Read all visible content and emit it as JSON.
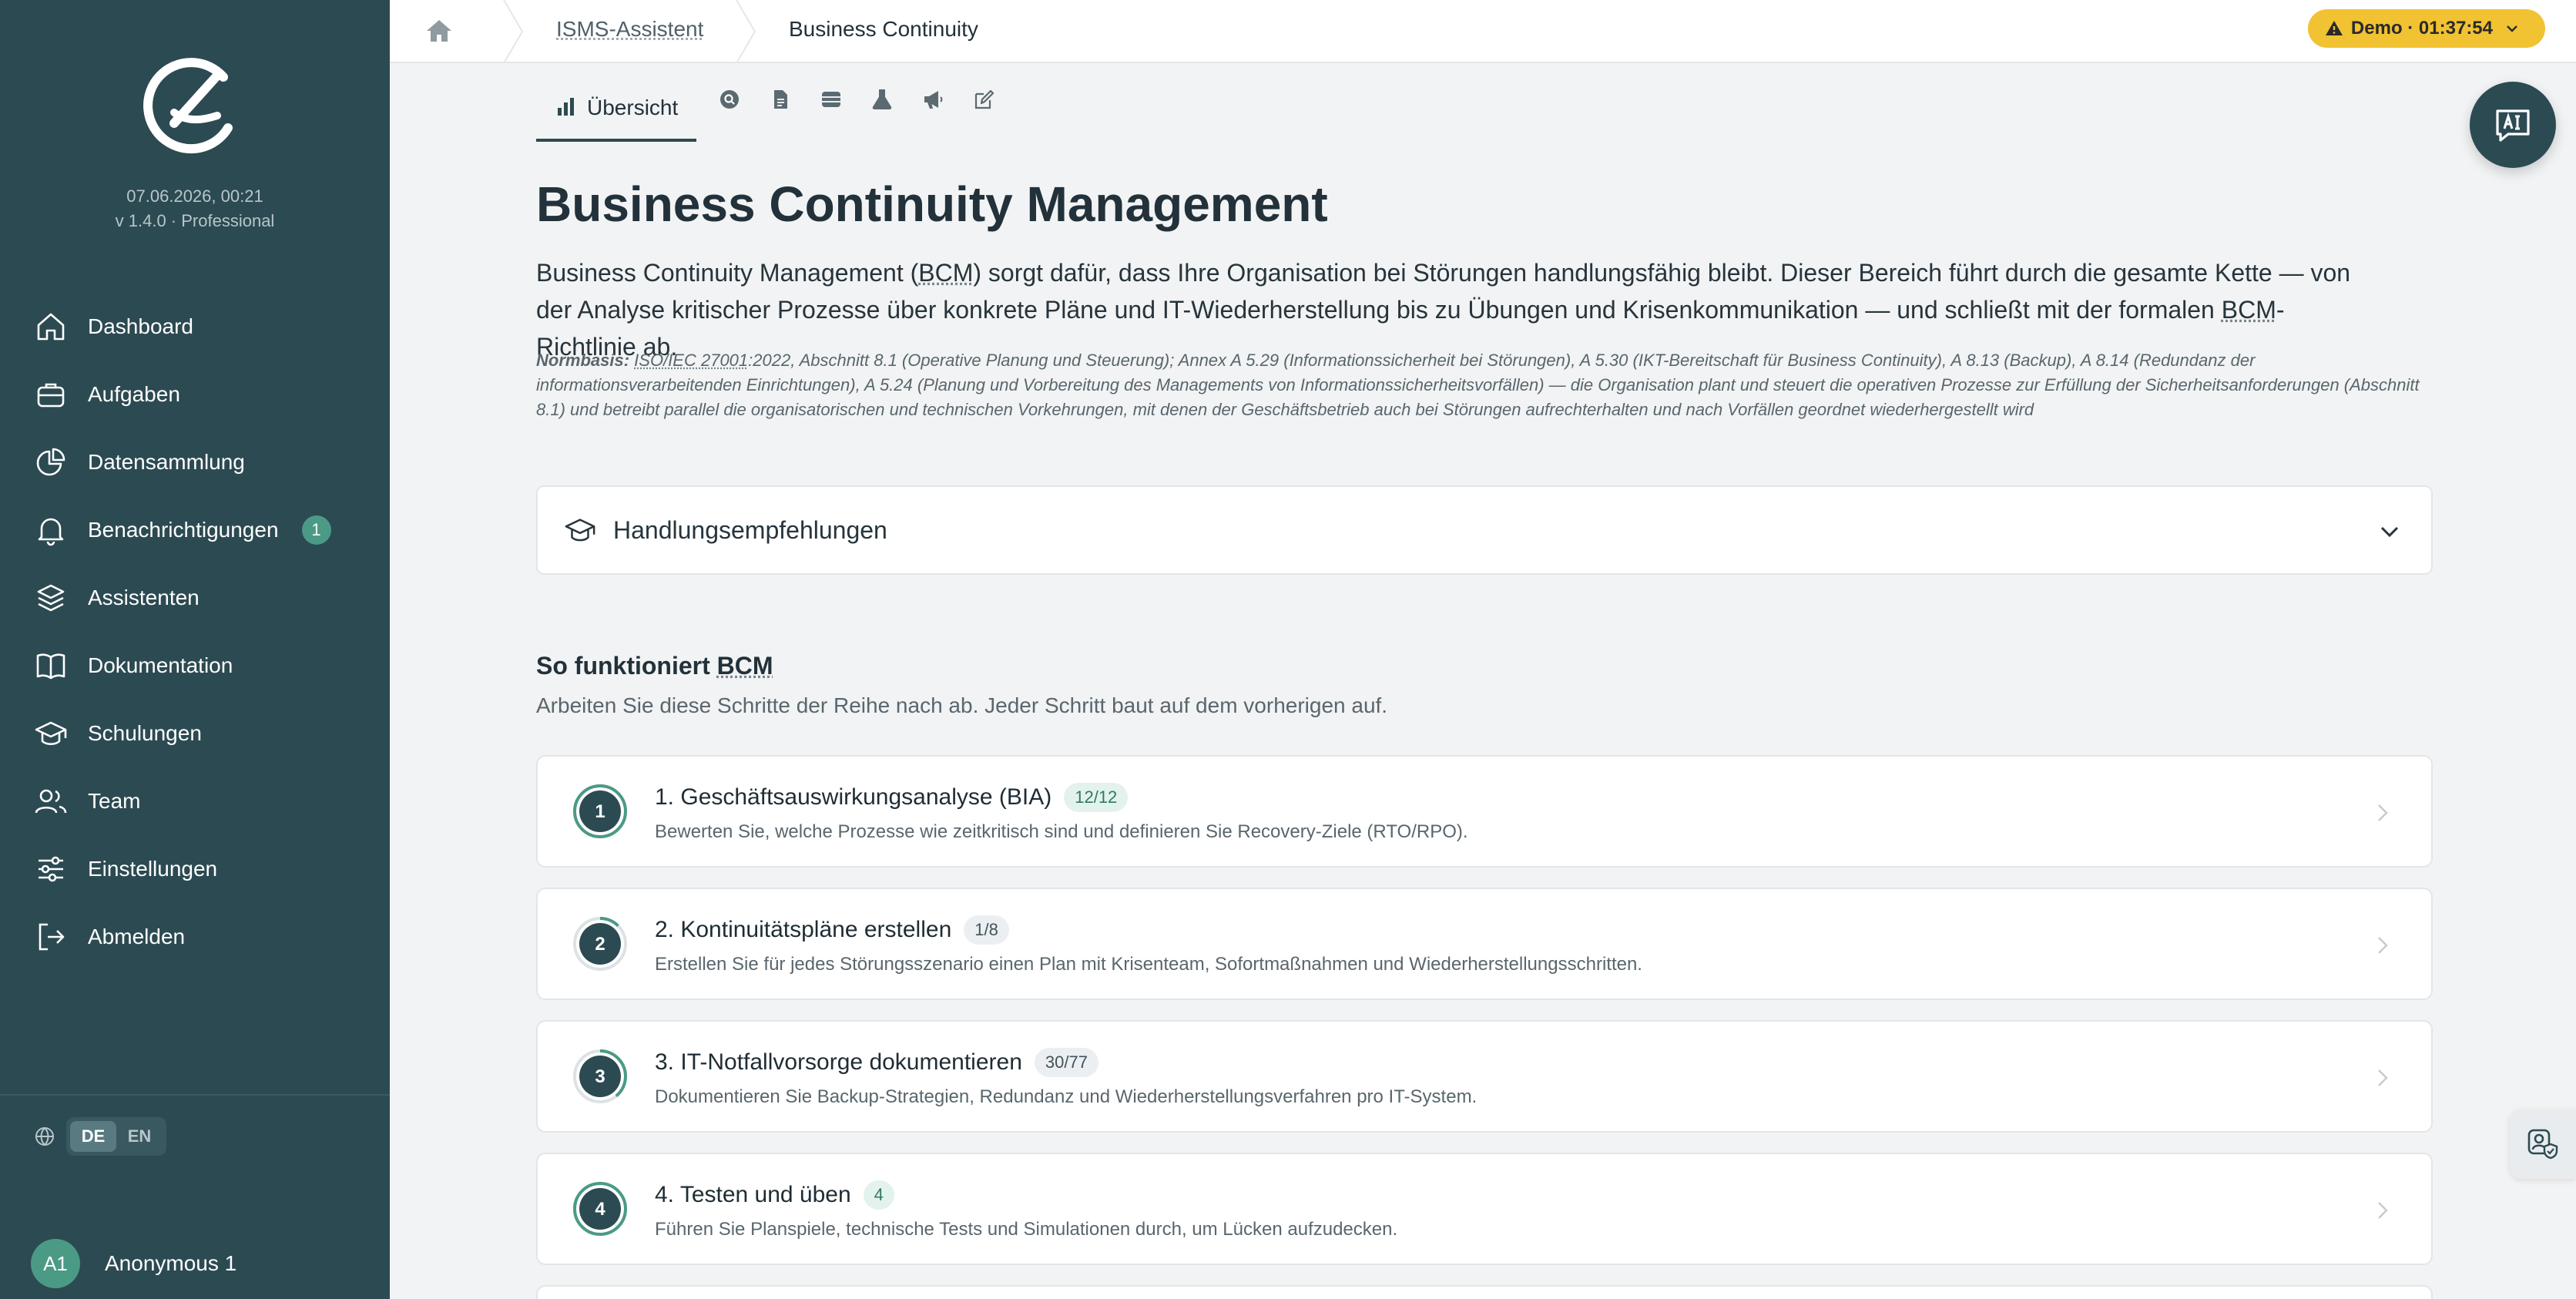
{
  "sidebar": {
    "date": "07.06.2026, 00:21",
    "version": "v 1.4.0 · Professional",
    "nav": [
      {
        "label": "Dashboard"
      },
      {
        "label": "Aufgaben"
      },
      {
        "label": "Datensammlung"
      },
      {
        "label": "Benachrichtigungen",
        "badge": "1"
      },
      {
        "label": "Assistenten"
      },
      {
        "label": "Dokumentation"
      },
      {
        "label": "Schulungen"
      },
      {
        "label": "Team"
      },
      {
        "label": "Einstellungen"
      },
      {
        "label": "Abmelden"
      }
    ],
    "lang": {
      "de": "DE",
      "en": "EN",
      "active": "DE"
    },
    "user": {
      "initials": "A1",
      "name": "Anonymous 1"
    }
  },
  "topbar": {
    "breadcrumb": [
      "ISMS-Assistent",
      "Business Continuity"
    ],
    "demo": "Demo · 01:37:54"
  },
  "tabs": {
    "overview_label": "Übersicht",
    "icons": [
      "search-icon",
      "document-icon",
      "database-icon",
      "flask-icon",
      "megaphone-icon",
      "edit-icon"
    ]
  },
  "page": {
    "title": "Business Continuity Management",
    "intro_1": "Business Continuity Management (",
    "intro_abbr_1": "BCM",
    "intro_2": ") sorgt dafür, dass Ihre Organisation bei Störungen handlungsfähig bleibt. Dieser Bereich führt durch die gesamte Kette — von der Analyse kritischer Prozesse über konkrete Pläne und IT-Wiederherstellung bis zu Übungen und Krisenkommunikation — und schließt mit der formalen ",
    "intro_abbr_2": "BCM",
    "intro_3": "-Richtlinie ab.",
    "norm_label": "Normbasis:",
    "norm_link": "ISO/IEC 27001",
    "norm_text": ":2022, Abschnitt 8.1 (Operative Planung und Steuerung); Annex A 5.29 (Informationssicherheit bei Störungen), A 5.30 (IKT-Bereitschaft für Business Continuity), A 8.13 (Backup), A 8.14 (Redundanz der informationsverarbeitenden Einrichtungen), A 5.24 (Planung und Vorbereitung des Managements von Informationssicherheitsvorfällen) — die Organisation plant und steuert die operativen Prozesse zur Erfüllung der Sicherheitsanforderungen (Abschnitt 8.1) und betreibt parallel die organisatorischen und technischen Vorkehrungen, mit denen der Geschäftsbetrieb auch bei Störungen aufrechterhalten und nach Vorfällen geordnet wiederhergestellt wird",
    "recommendations": "Handlungsempfehlungen",
    "section_title_1": "So funktioniert ",
    "section_title_abbr": "BCM",
    "section_sub": "Arbeiten Sie diese Schritte der Reihe nach ab. Jeder Schritt baut auf dem vorherigen auf."
  },
  "steps": [
    {
      "num": "1",
      "title": "1. Geschäftsauswirkungsanalyse (BIA)",
      "badge": "12/12",
      "badge_style": "green",
      "progress": 1.0,
      "desc": "Bewerten Sie, welche Prozesse wie zeitkritisch sind und definieren Sie Recovery-Ziele (RTO/RPO)."
    },
    {
      "num": "2",
      "title": "2. Kontinuitätspläne erstellen",
      "badge": "1/8",
      "badge_style": "gray",
      "progress": 0.125,
      "desc": "Erstellen Sie für jedes Störungsszenario einen Plan mit Krisenteam, Sofortmaßnahmen und Wiederherstellungsschritten."
    },
    {
      "num": "3",
      "title": "3. IT-Notfallvorsorge dokumentieren",
      "badge": "30/77",
      "badge_style": "gray",
      "progress": 0.39,
      "desc": "Dokumentieren Sie Backup-Strategien, Redundanz und Wiederherstellungsverfahren pro IT-System."
    },
    {
      "num": "4",
      "title": "4. Testen und üben",
      "badge": "4",
      "badge_style": "green",
      "progress": 1.0,
      "desc": "Führen Sie Planspiele, technische Tests und Simulationen durch, um Lücken aufzudecken."
    }
  ],
  "colors": {
    "sidebar": "#2c4a52",
    "accent": "#4b9a86",
    "demo": "#f1c232"
  }
}
